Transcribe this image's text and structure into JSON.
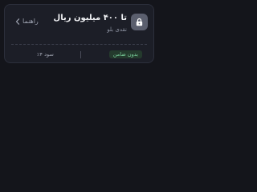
{
  "loan_card": {
    "title": "تا ۴۰۰ میلیون ریال",
    "subtitle": "نقدی بلو",
    "guide_label": "راهنما",
    "badge": "بدون ضامن",
    "profit_text": "سود ۴٪",
    "icons": {
      "lock": "lock-icon",
      "guide_chevron": "chevron-left-icon"
    },
    "colors": {
      "page_background": "#14151b",
      "card_background": "#1c1e27",
      "badge_background": "#243a2d",
      "badge_text": "#7ed6a0",
      "lock_tile": "#5b5f6e"
    }
  }
}
